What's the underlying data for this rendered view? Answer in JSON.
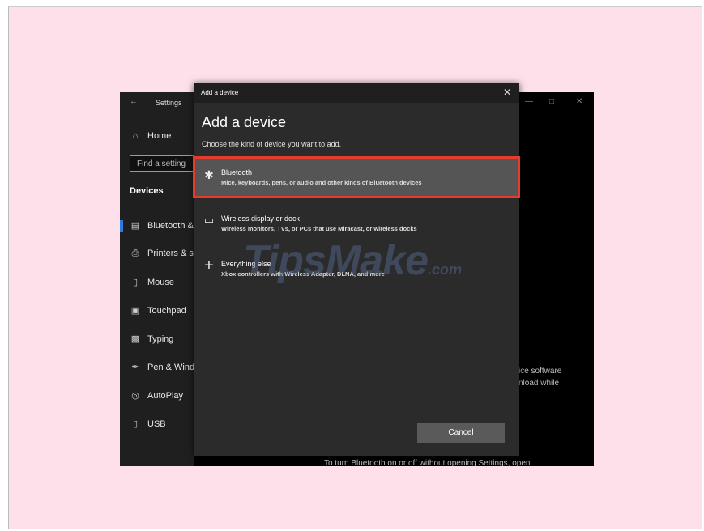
{
  "settings": {
    "title": "Settings",
    "back_icon": "back-arrow-icon",
    "home_label": "Home",
    "search_placeholder": "Find a setting",
    "section_heading": "Devices",
    "nav": [
      {
        "label": "Bluetooth &",
        "icon": "bluetooth-devices-icon"
      },
      {
        "label": "Printers & s",
        "icon": "printer-icon"
      },
      {
        "label": "Mouse",
        "icon": "mouse-icon"
      },
      {
        "label": "Touchpad",
        "icon": "touchpad-icon"
      },
      {
        "label": "Typing",
        "icon": "keyboard-icon"
      },
      {
        "label": "Pen & Wind",
        "icon": "pen-icon"
      },
      {
        "label": "AutoPlay",
        "icon": "autoplay-icon"
      },
      {
        "label": "USB",
        "icon": "usb-icon"
      }
    ],
    "background_text": {
      "line1": "ice software",
      "line2": "nload while",
      "bottom": "To turn Bluetooth on or off without opening Settings, open"
    }
  },
  "dialog": {
    "titlebar": "Add a device",
    "heading": "Add a device",
    "subtitle": "Choose the kind of device you want to add.",
    "options": [
      {
        "title": "Bluetooth",
        "description": "Mice, keyboards, pens, or audio and other kinds of Bluetooth devices",
        "icon": "bluetooth-icon"
      },
      {
        "title": "Wireless display or dock",
        "description": "Wireless monitors, TVs, or PCs that use Miracast, or wireless docks",
        "icon": "monitor-icon"
      },
      {
        "title": "Everything else",
        "description": "Xbox controllers with Wireless Adapter, DLNA, and more",
        "icon": "plus-icon"
      }
    ],
    "cancel_label": "Cancel"
  },
  "watermark": {
    "text": "TipsMake",
    "suffix": ".com"
  },
  "colors": {
    "highlight_border": "#e53b2c",
    "selected_bg": "#555555",
    "page_bg": "#fde0ea"
  }
}
